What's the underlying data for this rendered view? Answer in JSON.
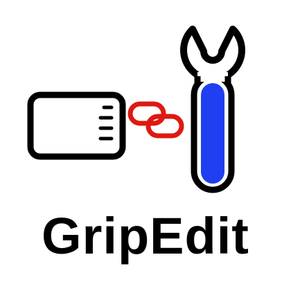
{
  "app": {
    "name": "GripEdit"
  },
  "icons": {
    "card": "grip-card-icon",
    "link": "chain-link-icon",
    "wrench": "wrench-icon"
  },
  "colors": {
    "outline": "#000000",
    "background": "#ffffff",
    "wrench_fill": "#1f3ff0",
    "link": "#dd1a12",
    "text": "#000000"
  }
}
